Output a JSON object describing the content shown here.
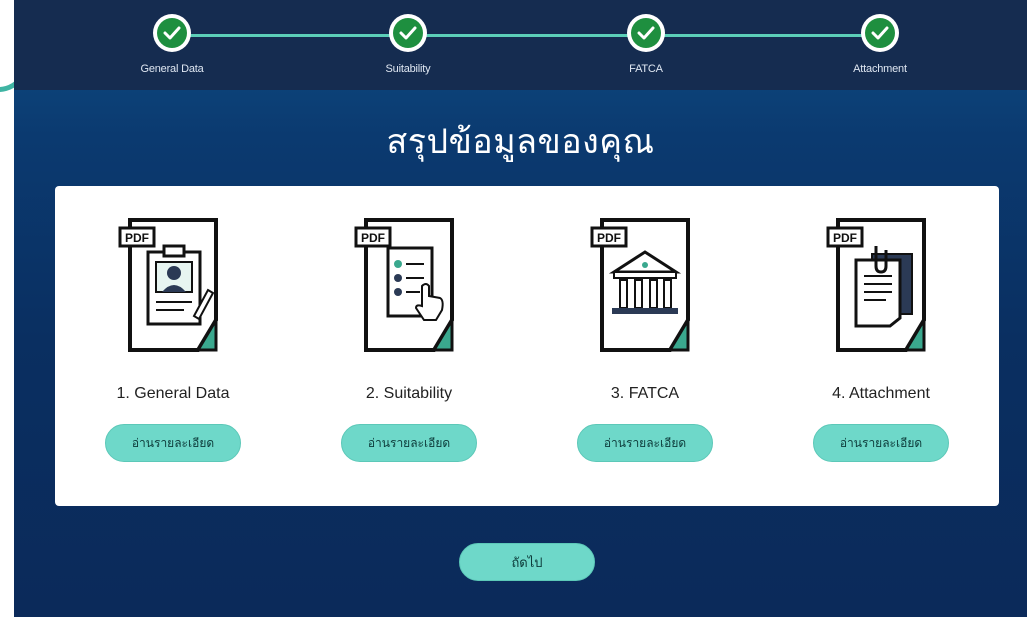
{
  "stepper": {
    "steps": [
      {
        "label": "General Data",
        "status": "completed"
      },
      {
        "label": "Suitability",
        "status": "completed"
      },
      {
        "label": "FATCA",
        "status": "completed"
      },
      {
        "label": "Attachment",
        "status": "completed"
      }
    ]
  },
  "page": {
    "title": "สรุปข้อมูลของคุณ"
  },
  "documents": [
    {
      "badge": "PDF",
      "label": "1. General Data",
      "button": "อ่านรายละเอียด",
      "icon": "profile-document-icon"
    },
    {
      "badge": "PDF",
      "label": "2. Suitability",
      "button": "อ่านรายละเอียด",
      "icon": "checklist-document-icon"
    },
    {
      "badge": "PDF",
      "label": "3. FATCA",
      "button": "อ่านรายละเอียด",
      "icon": "bank-document-icon"
    },
    {
      "badge": "PDF",
      "label": "4. Attachment",
      "button": "อ่านรายละเอียด",
      "icon": "clipboard-attachment-icon"
    }
  ],
  "footer": {
    "next_label": "ถัดไป"
  },
  "colors": {
    "accent": "#6ed8c9",
    "stepper_bg": "#152c50",
    "check": "#1e8f3f",
    "page_bg": "#0b3a70",
    "doc_fold": "#3aa88e"
  }
}
